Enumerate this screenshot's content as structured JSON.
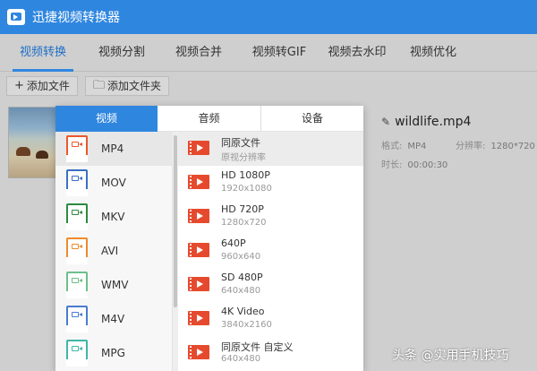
{
  "app": {
    "title": "迅捷视频转换器",
    "accent": "#2f86df"
  },
  "nav": {
    "tabs": [
      {
        "label": "视频转换",
        "active": true
      },
      {
        "label": "视频分割"
      },
      {
        "label": "视频合并"
      },
      {
        "label": "视频转GIF"
      },
      {
        "label": "视频去水印"
      },
      {
        "label": "视频优化"
      }
    ]
  },
  "toolbar": {
    "add_file": {
      "icon": "plus-icon",
      "label": "添加文件"
    },
    "add_folder": {
      "icon": "folder-icon",
      "label": "添加文件夹"
    }
  },
  "file": {
    "name": "wildlife.mp4",
    "format_key": "格式:",
    "format_val": "MP4",
    "resolution_key": "分辨率:",
    "resolution_val": "1280*720",
    "duration_key": "时长:",
    "duration_val": "00:00:30"
  },
  "dropdown": {
    "tabs": [
      {
        "label": "视频",
        "active": true
      },
      {
        "label": "音频"
      },
      {
        "label": "设备"
      }
    ],
    "formats": [
      {
        "label": "MP4",
        "tag": "MP4",
        "color": "#e8582c",
        "selected": true
      },
      {
        "label": "MOV",
        "tag": "MOV",
        "color": "#3a6fc4"
      },
      {
        "label": "MKV",
        "tag": "MKV",
        "color": "#2c8a3e"
      },
      {
        "label": "AVI",
        "tag": "AVI",
        "color": "#ef8a2a"
      },
      {
        "label": "WMV",
        "tag": "WMV",
        "color": "#6bc08a"
      },
      {
        "label": "M4V",
        "tag": "M4V",
        "color": "#4a7bd0"
      },
      {
        "label": "MPG",
        "tag": "MPG",
        "color": "#3fb6a8"
      }
    ],
    "presets": [
      {
        "name": "同原文件",
        "sub": "原视分辨率",
        "selected": true
      },
      {
        "name": "HD 1080P",
        "sub": "1920x1080"
      },
      {
        "name": "HD 720P",
        "sub": "1280x720"
      },
      {
        "name": "640P",
        "sub": "960x640"
      },
      {
        "name": "SD 480P",
        "sub": "640x480"
      },
      {
        "name": "4K Video",
        "sub": "3840x2160"
      },
      {
        "name": "同原文件 自定义",
        "sub": "640x480"
      }
    ]
  },
  "watermark": "头条 @实用手机技巧"
}
